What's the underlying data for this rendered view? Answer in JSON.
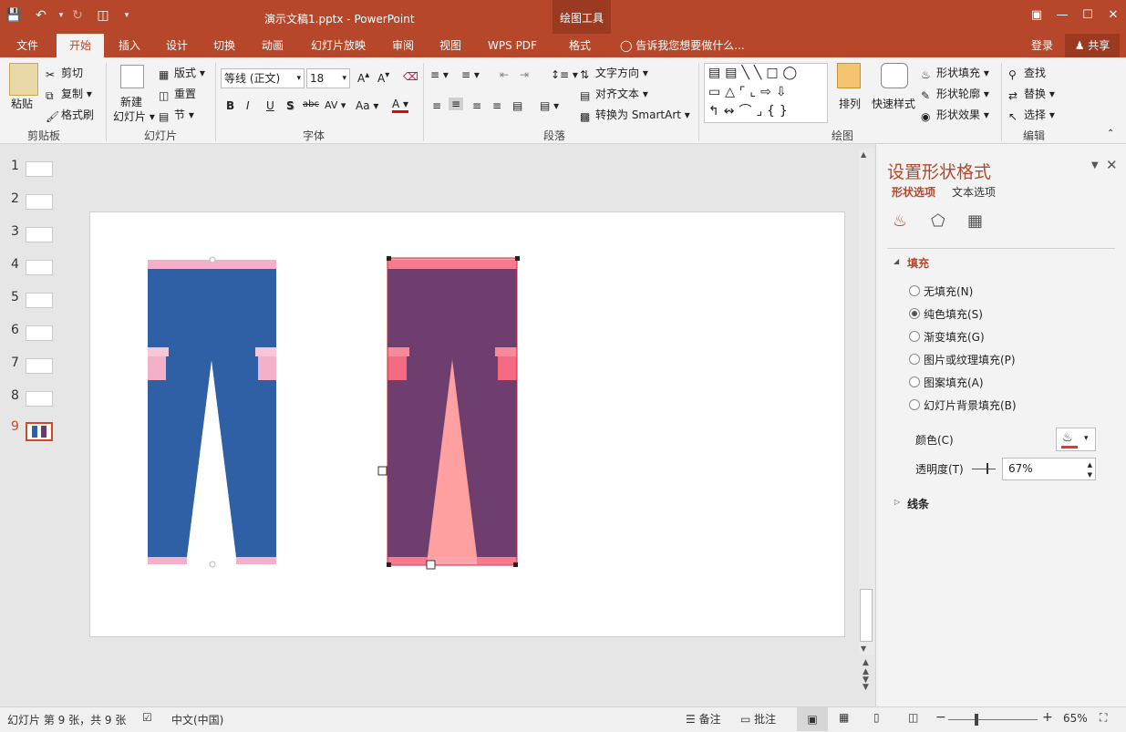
{
  "window": {
    "title": "演示文稿1.pptx - PowerPoint",
    "context_tab": "绘图工具"
  },
  "tabs": [
    "文件",
    "开始",
    "插入",
    "设计",
    "切换",
    "动画",
    "幻灯片放映",
    "审阅",
    "视图",
    "WPS PDF",
    "格式"
  ],
  "active_tab": "开始",
  "tell_me": "告诉我您想要做什么...",
  "signin": "登录",
  "share": "共享",
  "ribbon": {
    "clipboard": {
      "paste": "粘贴",
      "cut": "剪切",
      "copy": "复制",
      "format_painter": "格式刷",
      "label": "剪贴板"
    },
    "slides": {
      "new_slide_line1": "新建",
      "new_slide_line2": "幻灯片",
      "layout": "版式",
      "reset": "重置",
      "section": "节",
      "label": "幻灯片"
    },
    "font": {
      "font_name": "等线 (正文)",
      "font_size": "18",
      "label": "字体",
      "bold": "B",
      "italic": "I",
      "underline": "U",
      "shadow": "S",
      "strike": "abc",
      "spacing": "AV",
      "case": "Aa",
      "color": "A"
    },
    "paragraph": {
      "text_direction": "文字方向",
      "align_text": "对齐文本",
      "convert_smartart": "转换为 SmartArt",
      "label": "段落"
    },
    "drawing": {
      "arrange": "排列",
      "quick_styles": "快速样式",
      "shape_fill": "形状填充",
      "shape_outline": "形状轮廓",
      "shape_effects": "形状效果",
      "label": "绘图"
    },
    "editing": {
      "find": "查找",
      "replace": "替换",
      "select": "选择",
      "label": "编辑"
    }
  },
  "thumbnails": [
    "1",
    "2",
    "3",
    "4",
    "5",
    "6",
    "7",
    "8",
    "9"
  ],
  "selected_slide": "9",
  "format_pane": {
    "title": "设置形状格式",
    "tab_shape": "形状选项",
    "tab_text": "文本选项",
    "fill_header": "填充",
    "options": [
      "无填充(N)",
      "纯色填充(S)",
      "渐变填充(G)",
      "图片或纹理填充(P)",
      "图案填充(A)",
      "幻灯片背景填充(B)"
    ],
    "selected_option": "纯色填充(S)",
    "color_label": "颜色(C)",
    "transparency_label": "透明度(T)",
    "transparency_value": "67%",
    "line_header": "线条"
  },
  "status": {
    "slide_info": "幻灯片 第 9 张，共 9 张",
    "language": "中文(中国)",
    "notes": "备注",
    "comments": "批注",
    "zoom": "65%"
  },
  "colors": {
    "accent": "#b7472a",
    "pants_blue": "#2f5fa5",
    "pants_pink": "#f4b0c8",
    "overlay_red": "#ff4a5a"
  }
}
